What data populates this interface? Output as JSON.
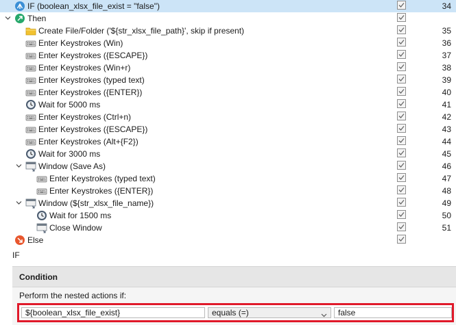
{
  "tree": {
    "rows": [
      {
        "label": "IF (boolean_xlsx_file_exist = \"false\")",
        "line": "34",
        "icon": "if-icon",
        "expander": "none",
        "indent": 0,
        "selected": true,
        "checked": true
      },
      {
        "label": "Then",
        "line": "",
        "icon": "then-icon",
        "expander": "open",
        "indent": 0,
        "selected": false,
        "checked": true
      },
      {
        "label": "Create File/Folder ('${str_xlsx_file_path}', skip if present)",
        "line": "35",
        "icon": "folder-icon",
        "expander": "none",
        "indent": 1,
        "selected": false,
        "checked": true
      },
      {
        "label": "Enter Keystrokes (Win)",
        "line": "36",
        "icon": "keyboard-icon",
        "expander": "none",
        "indent": 1,
        "selected": false,
        "checked": true
      },
      {
        "label": "Enter Keystrokes ({ESCAPE})",
        "line": "37",
        "icon": "keyboard-icon",
        "expander": "none",
        "indent": 1,
        "selected": false,
        "checked": true
      },
      {
        "label": "Enter Keystrokes (Win+r)",
        "line": "38",
        "icon": "keyboard-icon",
        "expander": "none",
        "indent": 1,
        "selected": false,
        "checked": true
      },
      {
        "label": "Enter Keystrokes (typed text)",
        "line": "39",
        "icon": "keyboard-icon",
        "expander": "none",
        "indent": 1,
        "selected": false,
        "checked": true
      },
      {
        "label": "Enter Keystrokes ({ENTER})",
        "line": "40",
        "icon": "keyboard-icon",
        "expander": "none",
        "indent": 1,
        "selected": false,
        "checked": true
      },
      {
        "label": "Wait for 5000 ms",
        "line": "41",
        "icon": "clock-icon",
        "expander": "none",
        "indent": 1,
        "selected": false,
        "checked": true
      },
      {
        "label": "Enter Keystrokes (Ctrl+n)",
        "line": "42",
        "icon": "keyboard-icon",
        "expander": "none",
        "indent": 1,
        "selected": false,
        "checked": true
      },
      {
        "label": "Enter Keystrokes ({ESCAPE})",
        "line": "43",
        "icon": "keyboard-icon",
        "expander": "none",
        "indent": 1,
        "selected": false,
        "checked": true
      },
      {
        "label": "Enter Keystrokes (Alt+{F2})",
        "line": "44",
        "icon": "keyboard-icon",
        "expander": "none",
        "indent": 1,
        "selected": false,
        "checked": true
      },
      {
        "label": "Wait for 3000 ms",
        "line": "45",
        "icon": "clock-icon",
        "expander": "none",
        "indent": 1,
        "selected": false,
        "checked": true
      },
      {
        "label": "Window (Save As)",
        "line": "46",
        "icon": "window-icon",
        "expander": "open",
        "indent": 1,
        "selected": false,
        "checked": true
      },
      {
        "label": "Enter Keystrokes (typed text)",
        "line": "47",
        "icon": "keyboard-icon",
        "expander": "none",
        "indent": 2,
        "selected": false,
        "checked": true
      },
      {
        "label": "Enter Keystrokes ({ENTER})",
        "line": "48",
        "icon": "keyboard-icon",
        "expander": "none",
        "indent": 2,
        "selected": false,
        "checked": true
      },
      {
        "label": "Window (${str_xlsx_file_name})",
        "line": "49",
        "icon": "window-icon",
        "expander": "open",
        "indent": 1,
        "selected": false,
        "checked": true
      },
      {
        "label": "Wait for 1500 ms",
        "line": "50",
        "icon": "clock-icon",
        "expander": "none",
        "indent": 2,
        "selected": false,
        "checked": true
      },
      {
        "label": "Close Window",
        "line": "51",
        "icon": "window-icon",
        "expander": "none",
        "indent": 2,
        "selected": false,
        "checked": true
      },
      {
        "label": "Else",
        "line": "",
        "icon": "else-icon",
        "expander": "none",
        "indent": 0,
        "selected": false,
        "checked": true
      }
    ]
  },
  "section_title": "IF",
  "panel": {
    "header": "Condition",
    "perform_label": "Perform the nested actions if:",
    "left_operand": "${boolean_xlsx_file_exist}",
    "operator": "equals (=)",
    "right_operand": "false"
  },
  "colors": {
    "selection": "#cce4f7",
    "highlight_border": "#e0192a",
    "then_icon": "#27a86b",
    "else_icon": "#e8572e",
    "if_icon": "#3b8fd6",
    "folder_icon": "#f2c230"
  }
}
